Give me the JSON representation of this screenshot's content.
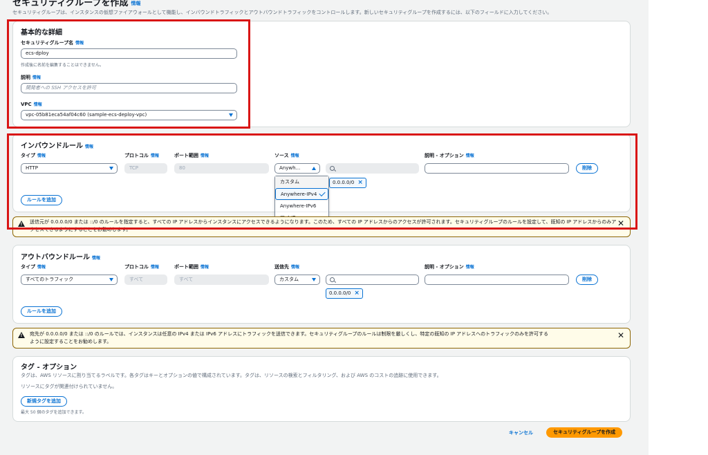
{
  "page": {
    "title": "セキュリティグループを作成",
    "title_info": "情報",
    "description": "セキュリティグループは、インスタンスの仮想ファイアウォールとして機能し、インバウンドトラフィックとアウトバウンドトラフィックをコントロールします。新しいセキュリティグループを作成するには、以下のフィールドに入力してください。"
  },
  "basic": {
    "heading": "基本的な詳細",
    "name_label": "セキュリティグループ名",
    "name_info": "情報",
    "name_value": "ecs-dploy",
    "name_hint": "作成後に名前を編集することはできません。",
    "desc_label": "説明",
    "desc_info": "情報",
    "desc_placeholder": "開発者への SSH アクセスを許可",
    "vpc_label": "VPC",
    "vpc_info": "情報",
    "vpc_value": "vpc-05b81eca54af04c60 (sample-ecs-deploy-vpc)"
  },
  "inbound": {
    "heading": "インバウンドルール",
    "heading_info": "情報",
    "col_type": "タイプ",
    "col_protocol": "プロトコル",
    "col_port": "ポート範囲",
    "col_source": "ソース",
    "col_desc": "説明 - オプション",
    "info": "情報",
    "type_value": "HTTP",
    "protocol_value": "TCP",
    "port_value": "80",
    "source_value": "Anywh...",
    "token": "0.0.0.0/0",
    "delete": "削除",
    "add_rule": "ルールを追加",
    "dropdown_options": [
      "カスタム",
      "Anywhere-IPv4",
      "Anywhere-IPv6",
      "マイ IP"
    ],
    "selected_option": "Anywhere-IPv4"
  },
  "inbound_warning": {
    "text": "送信元が 0.0.0.0/0 または ::/0 のルールを指定すると、すべての IP アドレスからインスタンスにアクセスできるようになります。このため、すべての IP アドレスからのアクセスが許可されます。セキュリティグループのルールを設定して、既知の IP アドレスからのみアクセスできるようにすることをお勧めします。"
  },
  "outbound": {
    "heading": "アウトバウンドルール",
    "heading_info": "情報",
    "col_type": "タイプ",
    "col_protocol": "プロトコル",
    "col_port": "ポート範囲",
    "col_dest": "送信先",
    "col_desc": "説明 - オプション",
    "info": "情報",
    "type_value": "すべてのトラフィック",
    "protocol_value": "すべて",
    "port_value": "すべて",
    "dest_value": "カスタム",
    "token": "0.0.0.0/0",
    "delete": "削除",
    "add_rule": "ルールを追加"
  },
  "outbound_warning": {
    "line1": "宛先が 0.0.0.0/0 または ::/0 のルールでは、インスタンスは任意の IPv4 または IPv6 アドレスにトラフィックを送信できます。セキュリティグループのルールは制限を厳しくし、特定の既知の IP アドレスへのトラフィックのみを許可する",
    "line2": "ように設定することをお勧めします。"
  },
  "tags": {
    "heading": "タグ - オプション",
    "description": "タグは、AWS リソースに割り当てるラベルです。各タグはキーとオプションの値で構成されています。タグは、リソースの検索とフィルタリング、および AWS のコストの追跡に使用できます。",
    "empty": "リソースにタグが関連付けられていません。",
    "add_tag": "新規タグを追加",
    "limit": "最大 50 個のタグを追加できます。"
  },
  "footer": {
    "cancel": "キャンセル",
    "create": "セキュリティグループを作成"
  }
}
